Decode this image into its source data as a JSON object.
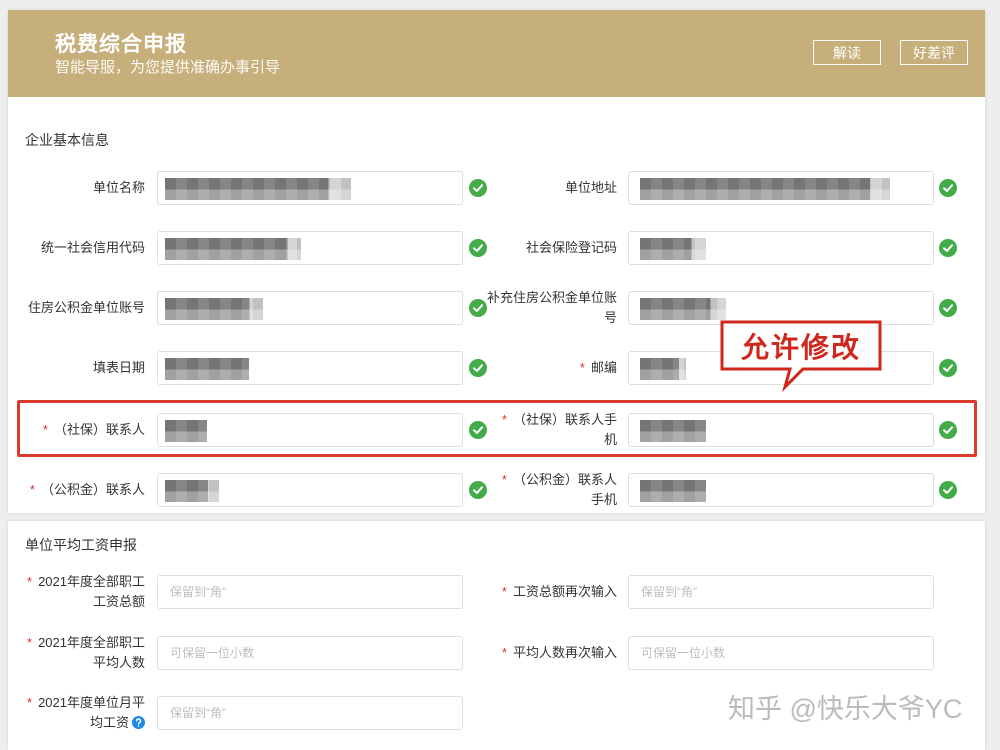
{
  "header": {
    "title": "税费综合申报",
    "subtitle": "智能导服，为您提供准确办事引导",
    "buttons": {
      "interpret": "解读",
      "review": "好差评"
    }
  },
  "required_mark": "*",
  "basic_info": {
    "section_title": "企业基本信息",
    "rows": [
      {
        "left": {
          "label_lines": [
            "单位名称"
          ]
        },
        "right": {
          "label_lines": [
            "单位地址"
          ]
        }
      },
      {
        "left": {
          "label_lines": [
            "统一社会信用代码"
          ]
        },
        "right": {
          "label_lines": [
            "社会保险登记码"
          ]
        }
      },
      {
        "left": {
          "label_lines": [
            "住房公积金单位账号"
          ]
        },
        "right": {
          "label_lines": [
            "补充住房公积金单位账",
            "号"
          ]
        }
      },
      {
        "left": {
          "label_lines": [
            "填表日期"
          ]
        },
        "right": {
          "label_lines": [
            "邮编"
          ]
        }
      },
      {
        "left": {
          "label_lines": [
            "（社保）联系人"
          ]
        },
        "right": {
          "label_lines": [
            "（社保）联系人手",
            "机"
          ]
        }
      },
      {
        "left": {
          "label_lines": [
            "（公积金）联系人"
          ]
        },
        "right": {
          "label_lines": [
            "（公积金）联系人",
            "手机"
          ]
        }
      }
    ]
  },
  "annotation": {
    "text": "允许修改"
  },
  "wage": {
    "section_title": "单位平均工资申报",
    "rows": [
      {
        "left": {
          "label_lines": [
            "2021年度全部职工",
            "工资总额"
          ],
          "placeholder": "保留到“角”"
        },
        "right": {
          "label_lines": [
            "工资总额再次输入"
          ],
          "placeholder": "保留到“角”"
        }
      },
      {
        "left": {
          "label_lines": [
            "2021年度全部职工",
            "平均人数"
          ],
          "placeholder": "可保留一位小数"
        },
        "right": {
          "label_lines": [
            "平均人数再次输入"
          ],
          "placeholder": "可保留一位小数"
        }
      },
      {
        "left": {
          "label_lines": [
            "2021年度单位月平",
            "均工资"
          ],
          "placeholder": "保留到“角”"
        }
      }
    ]
  },
  "watermark": "知乎 @快乐大爷YC",
  "colors": {
    "header_bg": "#c7af7c",
    "required": "#e02b2b",
    "highlight_border": "#d93a2b",
    "validated": "#42ab4a",
    "help": "#1e88e5"
  },
  "icons": {
    "validated": "check-circle-icon",
    "help": "help-circle-icon"
  }
}
